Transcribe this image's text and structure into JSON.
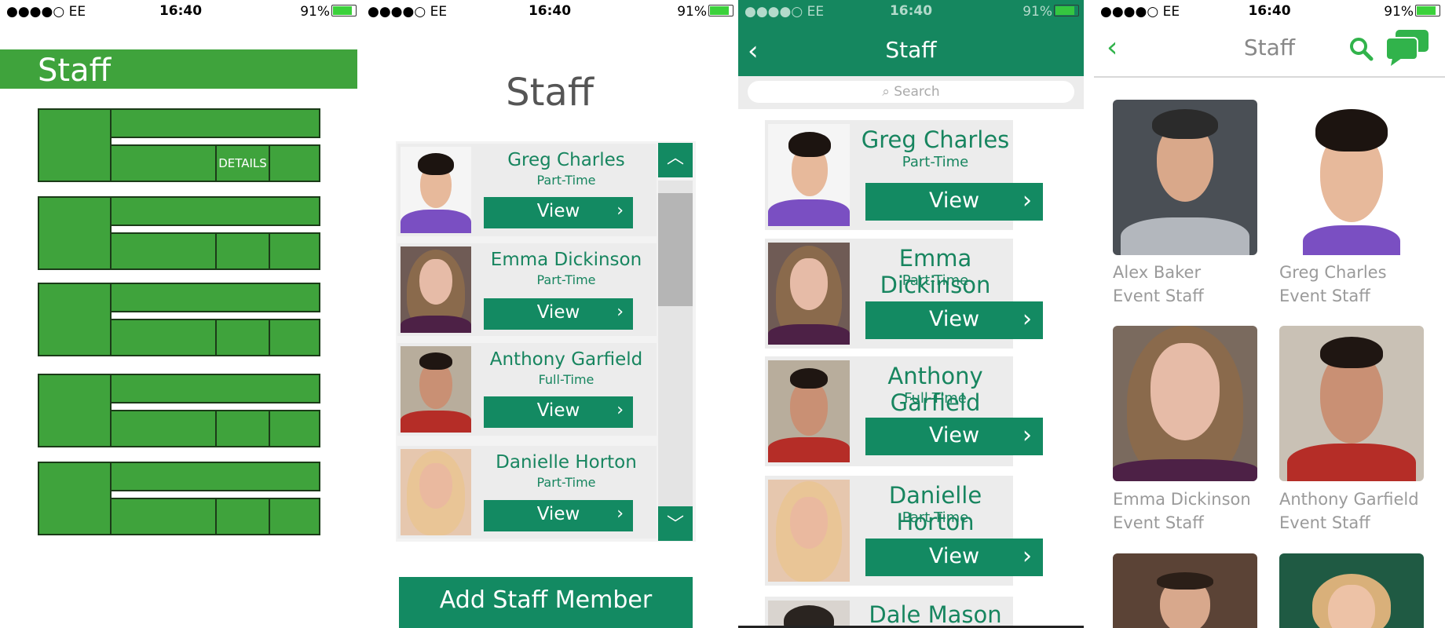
{
  "status": {
    "carrier": "●●●●○ EE",
    "time": "16:40",
    "battery": "91%"
  },
  "panel1": {
    "title": "Staff",
    "details_label": "DETAILS"
  },
  "panel2": {
    "title": "Staff",
    "view_label": "View",
    "add_label": "Add Staff Member",
    "staff": [
      {
        "name": "Greg Charles",
        "role": "Part-Time"
      },
      {
        "name": "Emma Dickinson",
        "role": "Part-Time"
      },
      {
        "name": "Anthony Garfield",
        "role": "Full-Time"
      },
      {
        "name": "Danielle Horton",
        "role": "Part-Time"
      }
    ]
  },
  "panel3": {
    "title": "Staff",
    "search_placeholder": "Search",
    "view_label": "View",
    "staff": [
      {
        "name": "Greg Charles",
        "role": "Part-Time"
      },
      {
        "name": "Emma Dickinson",
        "role": "Part-Time"
      },
      {
        "name": "Anthony Garfield",
        "role": "Full-Time"
      },
      {
        "name": "Danielle Horton",
        "role": "Part-Time"
      },
      {
        "name": "Dale Mason",
        "role": ""
      }
    ]
  },
  "panel4": {
    "title": "Staff",
    "staff": [
      {
        "name": "Alex Baker",
        "role": "Event Staff"
      },
      {
        "name": "Greg Charles",
        "role": "Event Staff"
      },
      {
        "name": "Emma Dickinson",
        "role": "Event Staff"
      },
      {
        "name": "Anthony Garfield",
        "role": "Event Staff"
      }
    ]
  },
  "colors": {
    "primary_green": "#138a62",
    "wireframe_green": "#3fa33c",
    "accent_green": "#31b34b"
  }
}
